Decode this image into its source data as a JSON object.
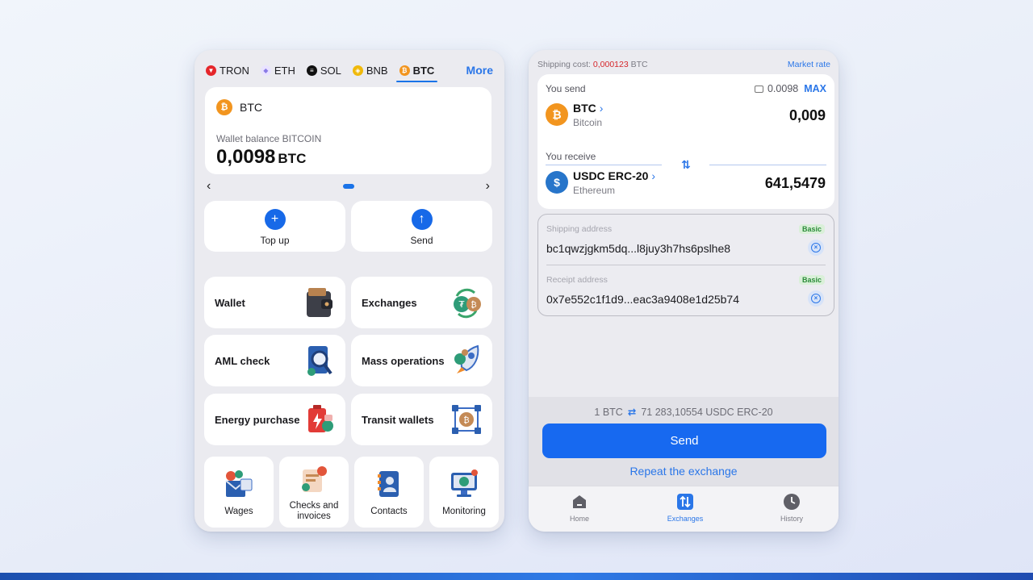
{
  "left_screen": {
    "chain_tabs": [
      {
        "label": "TRON",
        "color": "#e5262b"
      },
      {
        "label": "ETH",
        "color": "#8a7be6"
      },
      {
        "label": "SOL",
        "color": "#111111"
      },
      {
        "label": "BNB",
        "color": "#f0b90b"
      },
      {
        "label": "BTC",
        "color": "#f2951f"
      }
    ],
    "active_tab": "BTC",
    "more_label": "More",
    "balance_card": {
      "coin_symbol": "BTC",
      "balance_label": "Wallet balance BITCOIN",
      "balance_value": "0,0098",
      "balance_currency": "BTC"
    },
    "actions": {
      "top_up_label": "Top up",
      "top_up_icon": "plus-icon",
      "send_label": "Send",
      "send_icon": "arrow-up-icon"
    },
    "features": [
      {
        "label": "Wallet",
        "icon": "wallet-icon"
      },
      {
        "label": "Exchanges",
        "icon": "exchange-coins-icon"
      },
      {
        "label": "AML check",
        "icon": "magnifier-icon"
      },
      {
        "label": "Mass operations",
        "icon": "rocket-icon"
      },
      {
        "label": "Energy purchase",
        "icon": "battery-icon"
      },
      {
        "label": "Transit wallets",
        "icon": "network-icon"
      }
    ],
    "small_features": [
      {
        "label": "Wages",
        "icon": "wages-icon"
      },
      {
        "label": "Checks and invoices",
        "icon": "invoice-icon"
      },
      {
        "label": "Contacts",
        "icon": "contacts-book-icon"
      },
      {
        "label": "Monitoring",
        "icon": "monitor-icon"
      }
    ]
  },
  "right_screen": {
    "shipping_cost_label": "Shipping cost:",
    "shipping_cost_value": "0,000123",
    "shipping_cost_currency": "BTC",
    "market_rate_label": "Market rate",
    "you_send_label": "You send",
    "send_balance": "0.0098",
    "max_label": "MAX",
    "send_asset": {
      "name": "BTC",
      "network": "Bitcoin",
      "amount": "0,009",
      "color": "#f2951f"
    },
    "you_receive_label": "You receive",
    "receive_asset": {
      "name": "USDC ERC-20",
      "network": "Ethereum",
      "amount": "641,5479",
      "color": "#2775ca"
    },
    "shipping_address": {
      "label": "Shipping address",
      "badge": "Basic",
      "value": "bc1qwzjgkm5dq...l8juy3h7hs6pslhe8"
    },
    "receipt_address": {
      "label": "Receipt address",
      "badge": "Basic",
      "value": "0x7e552c1f1d9...eac3a9408e1d25b74"
    },
    "rate_left": "1 BTC",
    "rate_right": "71 283,10554 USDC ERC-20",
    "send_button": "Send",
    "repeat_link": "Repeat the exchange",
    "nav": [
      {
        "label": "Home",
        "icon": "home-icon"
      },
      {
        "label": "Exchanges",
        "icon": "exchange-icon"
      },
      {
        "label": "History",
        "icon": "clock-icon"
      }
    ]
  }
}
